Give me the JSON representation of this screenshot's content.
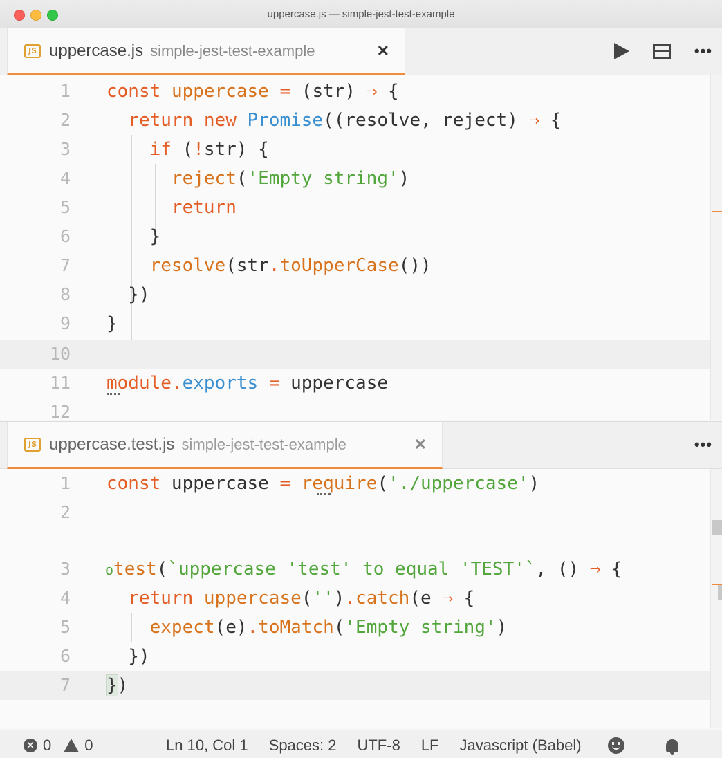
{
  "window": {
    "title": "uppercase.js — simple-jest-test-example"
  },
  "pane1": {
    "tab": {
      "icon": "JS",
      "name": "uppercase.js",
      "desc": "simple-jest-test-example",
      "close": "✕"
    },
    "actions": {
      "run": "play-icon",
      "split": "split-icon",
      "more": "•••"
    }
  },
  "pane2": {
    "tab": {
      "icon": "JS",
      "name": "uppercase.test.js",
      "desc": "simple-jest-test-example",
      "close": "✕"
    },
    "actions": {
      "more": "•••"
    }
  },
  "status": {
    "errors": "0",
    "warnings": "0",
    "position": "Ln 10, Col 1",
    "spaces": "Spaces: 2",
    "encoding": "UTF-8",
    "eol": "LF",
    "language": "Javascript (Babel)"
  },
  "colors": {
    "accent": "#f08a3c",
    "keyword": "#e35d25",
    "string": "#52a63c",
    "builtin": "#3a8fd0"
  }
}
